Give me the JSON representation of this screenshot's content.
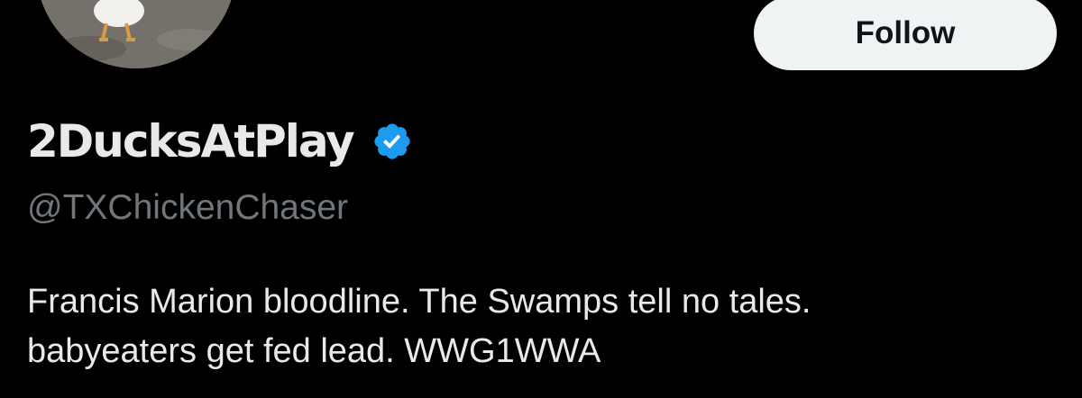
{
  "profile": {
    "display_name": "2DucksAtPlay",
    "handle": "@TXChickenChaser",
    "verified_icon": "verified-badge-icon",
    "avatar_icon": "duck-photo",
    "bio_lines": [
      "Francis Marion bloodline. The Swamps tell no tales.",
      "babyeaters get fed lead. WWG1WWA"
    ]
  },
  "actions": {
    "follow_label": "Follow"
  },
  "colors": {
    "background": "#000000",
    "primary_text": "#e7e9ea",
    "secondary_text": "#71767b",
    "verified_blue": "#1d9bf0",
    "follow_button_bg": "#eff3f4",
    "follow_button_text": "#0f1419"
  }
}
